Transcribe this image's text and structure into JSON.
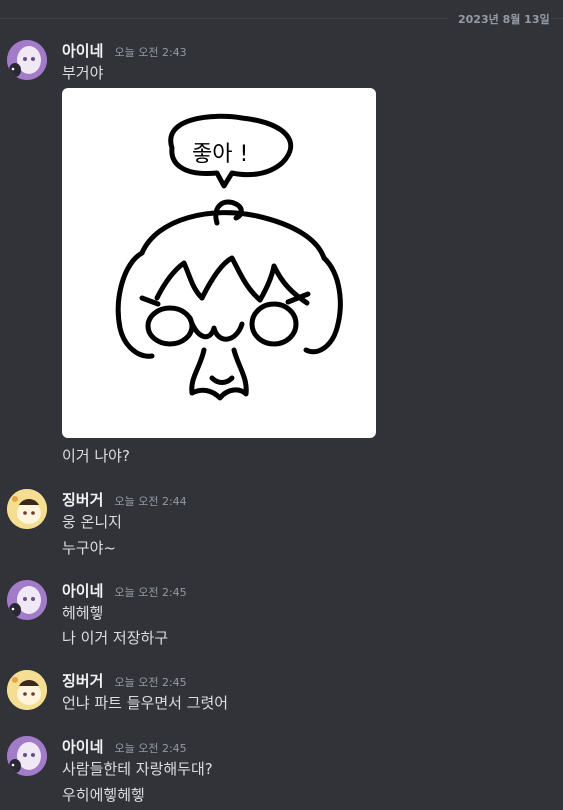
{
  "date_divider": "2023년 8월 13일",
  "messages": [
    {
      "user": "아이네",
      "time": "오늘 오전 2:43",
      "lines": [
        "부거야"
      ]
    },
    {
      "image_text": "좋아 !",
      "lines_after": [
        "이거 나야?"
      ]
    },
    {
      "user": "징버거",
      "time": "오늘 오전 2:44",
      "lines": [
        "웅 온니지",
        "누구야~"
      ]
    },
    {
      "user": "아이네",
      "time": "오늘 오전 2:45",
      "lines": [
        "헤헤헿",
        "나 이거 저장하구"
      ]
    },
    {
      "user": "징버거",
      "time": "오늘 오전 2:45",
      "lines": [
        "언냐 파트 들우면서 그렷어"
      ]
    },
    {
      "user": "아이네",
      "time": "오늘 오전 2:45",
      "lines": [
        "사람들한테 자랑해두대?",
        "우히에헿헤헿"
      ]
    }
  ],
  "colors": {
    "background": "#313338",
    "username": "#f2f3f5",
    "text": "#dbdee1",
    "muted": "#949ba4"
  }
}
